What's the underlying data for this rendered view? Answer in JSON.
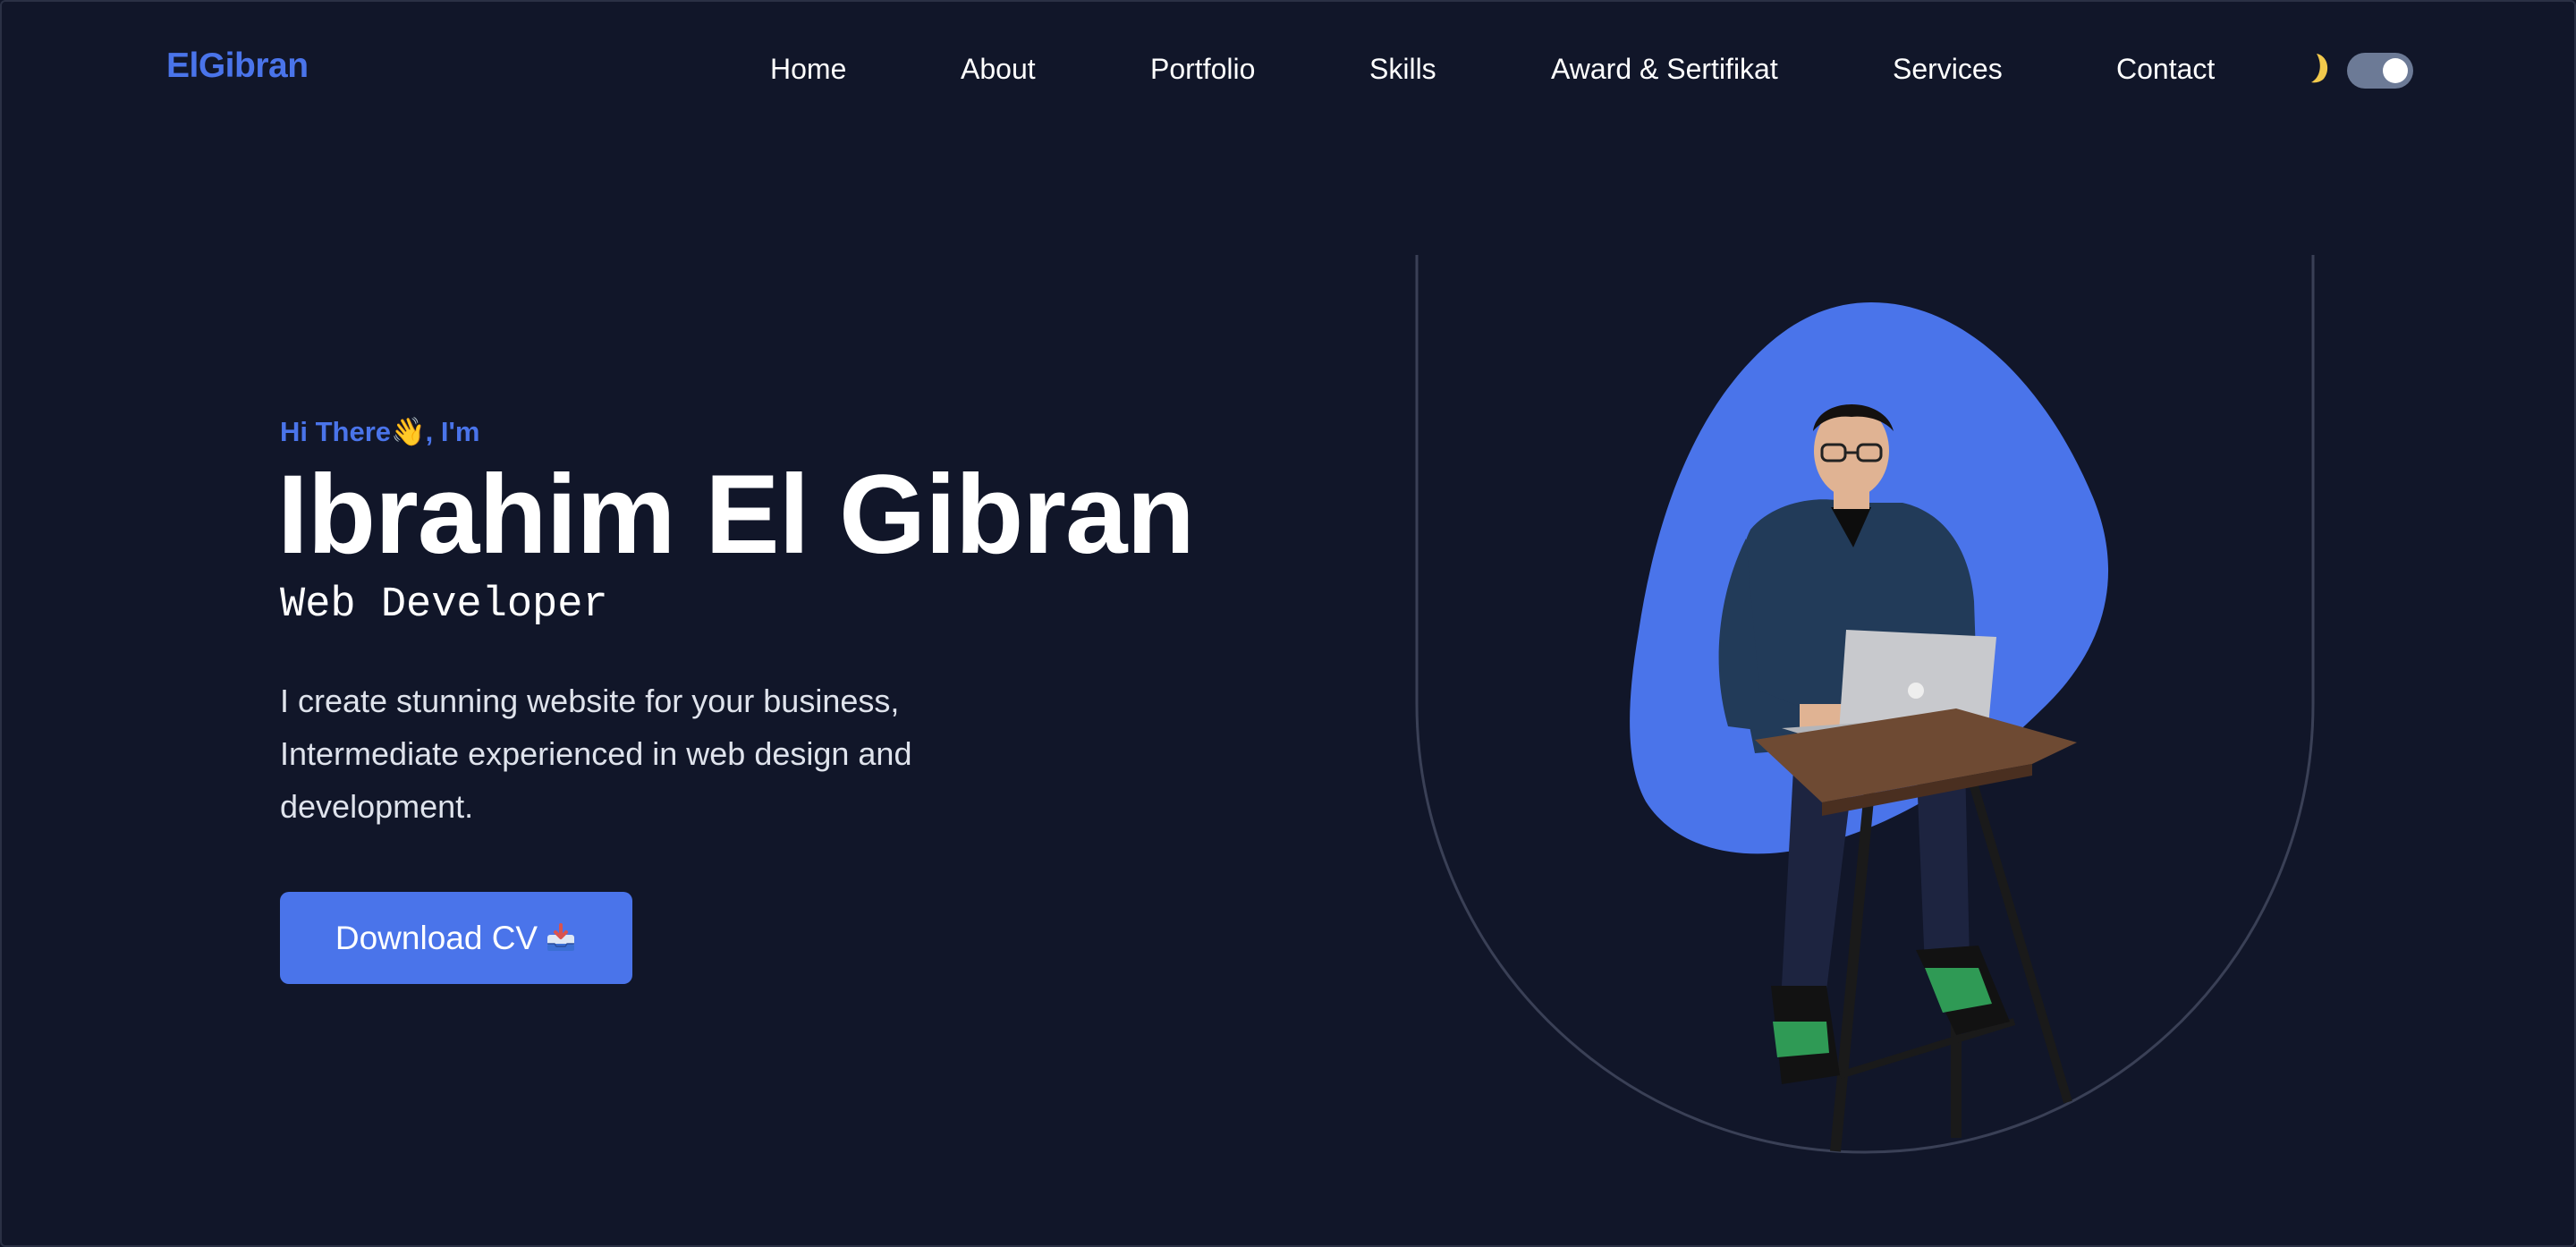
{
  "nav": {
    "logo": "ElGibran",
    "links": [
      {
        "label": "Home"
      },
      {
        "label": "About"
      },
      {
        "label": "Portfolio"
      },
      {
        "label": "Skills"
      },
      {
        "label": "Award & Sertifikat"
      },
      {
        "label": "Services"
      },
      {
        "label": "Contact"
      }
    ],
    "theme_icon": "moon-icon",
    "theme_toggle_on": true
  },
  "hero": {
    "greeting": "Hi There👋, I'm",
    "name": "Ibrahim El Gibran",
    "role": "Web Developer",
    "description": "I create stunning website for your business, Intermediate experienced in web design and development.",
    "cta_label": "Download CV",
    "cta_icon": "inbox-tray-icon",
    "image_icon": "portrait-photo"
  },
  "colors": {
    "background": "#111629",
    "accent": "#4a74ea",
    "text": "#ffffff",
    "toggle": "#6c7a96"
  }
}
